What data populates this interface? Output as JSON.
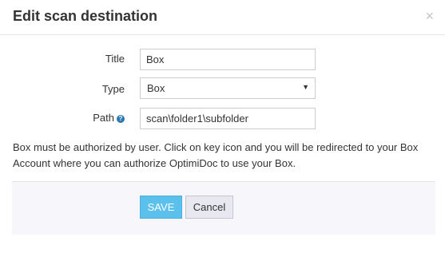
{
  "dialog": {
    "title": "Edit scan destination",
    "close_glyph": "×"
  },
  "form": {
    "title_label": "Title",
    "title_value": "Box",
    "type_label": "Type",
    "type_value": "Box",
    "path_label": "Path",
    "path_help_icon": "question-circle-icon",
    "path_value": "scan\\folder1\\subfolder"
  },
  "info_text": "Box must be authorized by user. Click on key icon and you will be redirected to your Box Account where you can authorize OptimiDoc to use your Box.",
  "footer": {
    "save_label": "SAVE",
    "cancel_label": "Cancel"
  },
  "colors": {
    "save_button": "#5bc0eb",
    "help_icon": "#2a7ab0",
    "footer_bg": "#f7f7fb"
  }
}
